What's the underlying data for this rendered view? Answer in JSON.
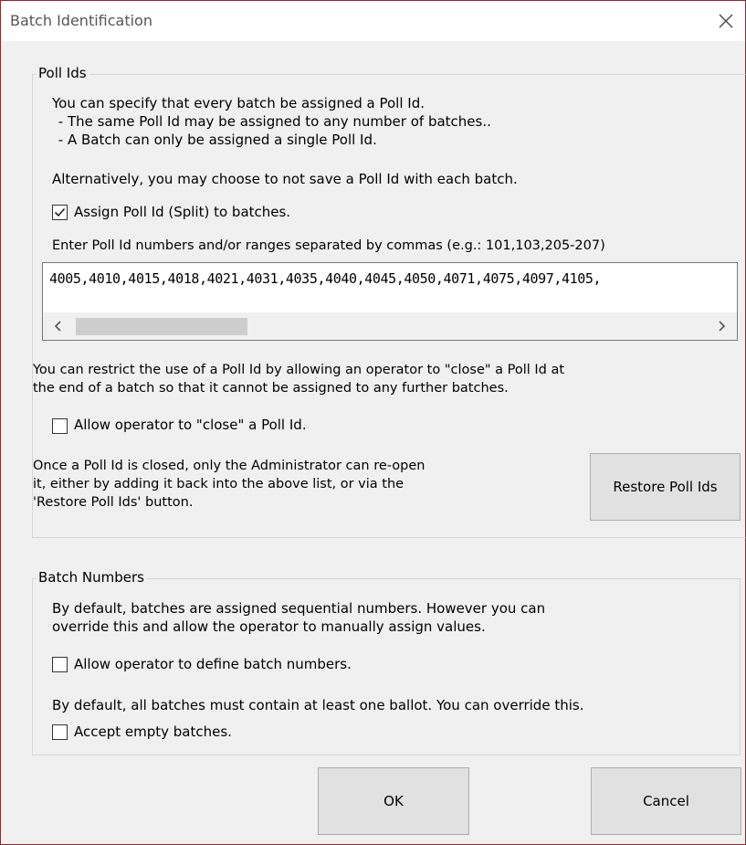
{
  "window": {
    "title": "Batch Identification",
    "close_icon": "close-icon"
  },
  "poll_ids": {
    "legend": "Poll Ids",
    "intro_line1": "You can specify that every batch be assigned a Poll Id.",
    "intro_line2": " - The same Poll Id may be assigned to any number of batches..",
    "intro_line3": " - A Batch can only be assigned a single Poll Id.",
    "alternative": "Alternatively, you may choose to not save a Poll Id with each batch.",
    "assign_checkbox": {
      "label": "Assign Poll Id (Split) to batches.",
      "checked": true
    },
    "enter_prompt": "Enter Poll Id numbers and/or ranges separated by commas (e.g.: 101,103,205-207)",
    "ids_value": "4005,4010,4015,4018,4021,4031,4035,4040,4045,4050,4071,4075,4097,4105,",
    "restrict_line1": "You can restrict the use of a Poll Id by allowing an operator to \"close\" a Poll Id at",
    "restrict_line2": "the end of a batch so that it cannot be assigned to any further batches.",
    "close_checkbox": {
      "label": "Allow operator to \"close\" a Poll Id.",
      "checked": false
    },
    "closed_line1": "Once a Poll Id is closed, only the Administrator can re-open",
    "closed_line2": "it, either by adding it back into the above list, or via the",
    "closed_line3": "'Restore Poll Ids' button.",
    "restore_button": "Restore Poll Ids"
  },
  "batch_numbers": {
    "legend": "Batch Numbers",
    "default_line1": "By default, batches are assigned sequential numbers. However you can",
    "default_line2": "override this and allow the operator to manually assign values.",
    "define_checkbox": {
      "label": "Allow operator to define batch numbers.",
      "checked": false
    },
    "empty_line": "By default, all batches must contain at least one ballot. You can override this.",
    "empty_checkbox": {
      "label": "Accept empty batches.",
      "checked": false
    }
  },
  "buttons": {
    "ok": "OK",
    "cancel": "Cancel"
  }
}
